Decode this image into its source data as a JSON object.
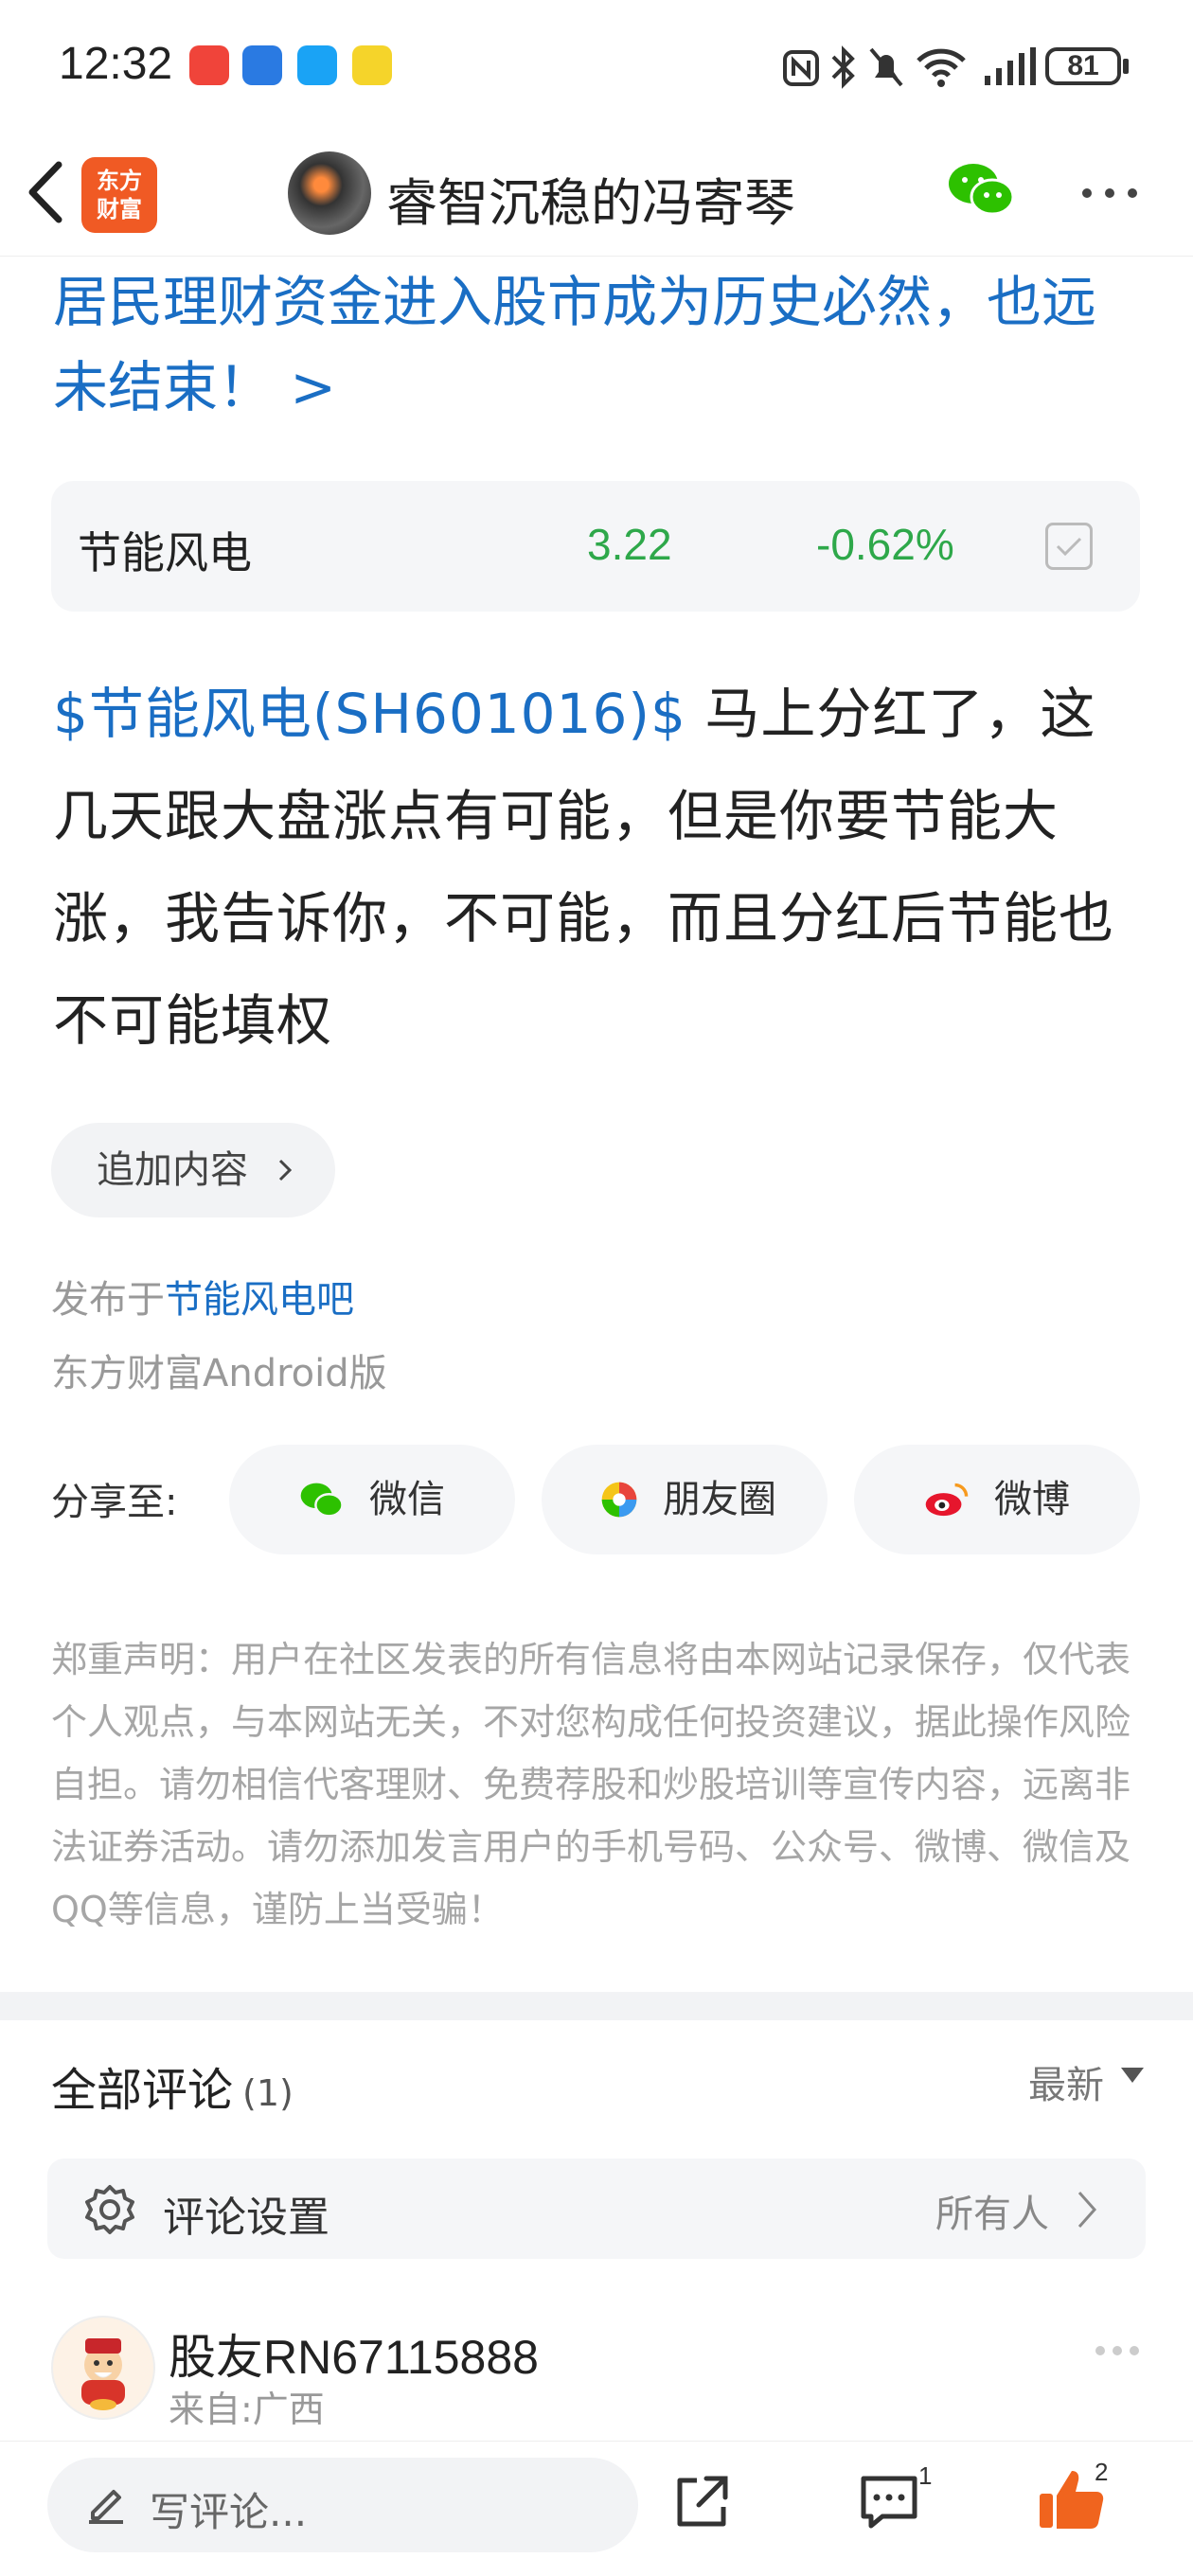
{
  "status_bar": {
    "time": "12:32",
    "battery": "81"
  },
  "nav": {
    "logo_line1": "东方",
    "logo_line2": "财富",
    "title": "睿智沉稳的冯寄琴"
  },
  "headline": "居民理财资金进入股市成为历史必然，也远未结束！ >",
  "stock": {
    "name": "节能风电",
    "price": "3.22",
    "change": "-0.62%",
    "color": "#2ea84a"
  },
  "post": {
    "tag": "$节能风电(SH601016)$",
    "body": "  马上分红了，这几天跟大盘涨点有可能，但是你要节能大涨，我告诉你，不可能，而且分红后节能也不可能填权"
  },
  "append_button": "追加内容",
  "meta": {
    "published_prefix": "发布于",
    "forum_link": "节能风电吧",
    "client": "东方财富Android版"
  },
  "share": {
    "label": "分享至:",
    "buttons": [
      {
        "label": "微信",
        "icon": "wechat-icon"
      },
      {
        "label": "朋友圈",
        "icon": "moments-icon"
      },
      {
        "label": "微博",
        "icon": "weibo-icon"
      }
    ]
  },
  "disclaimer": "郑重声明：用户在社区发表的所有信息将由本网站记录保存，仅代表个人观点，与本网站无关，不对您构成任何投资建议，据此操作风险自担。请勿相信代客理财、免费荐股和炒股培训等宣传内容，远离非法证券活动。请勿添加发言用户的手机号码、公众号、微博、微信及QQ等信息，谨防上当受骗！",
  "comments": {
    "title": "全部评论",
    "count": "(1)",
    "sort": "最新",
    "settings_label": "评论设置",
    "settings_value": "所有人",
    "items": [
      {
        "user": "股友RN67115888",
        "location": "来自:广西"
      }
    ]
  },
  "bottom_bar": {
    "write_placeholder": "写评论...",
    "comment_count": "1",
    "like_count": "2"
  },
  "colors": {
    "accent": "#1a6ec4",
    "brand": "#f05a24",
    "like": "#f0641e"
  }
}
